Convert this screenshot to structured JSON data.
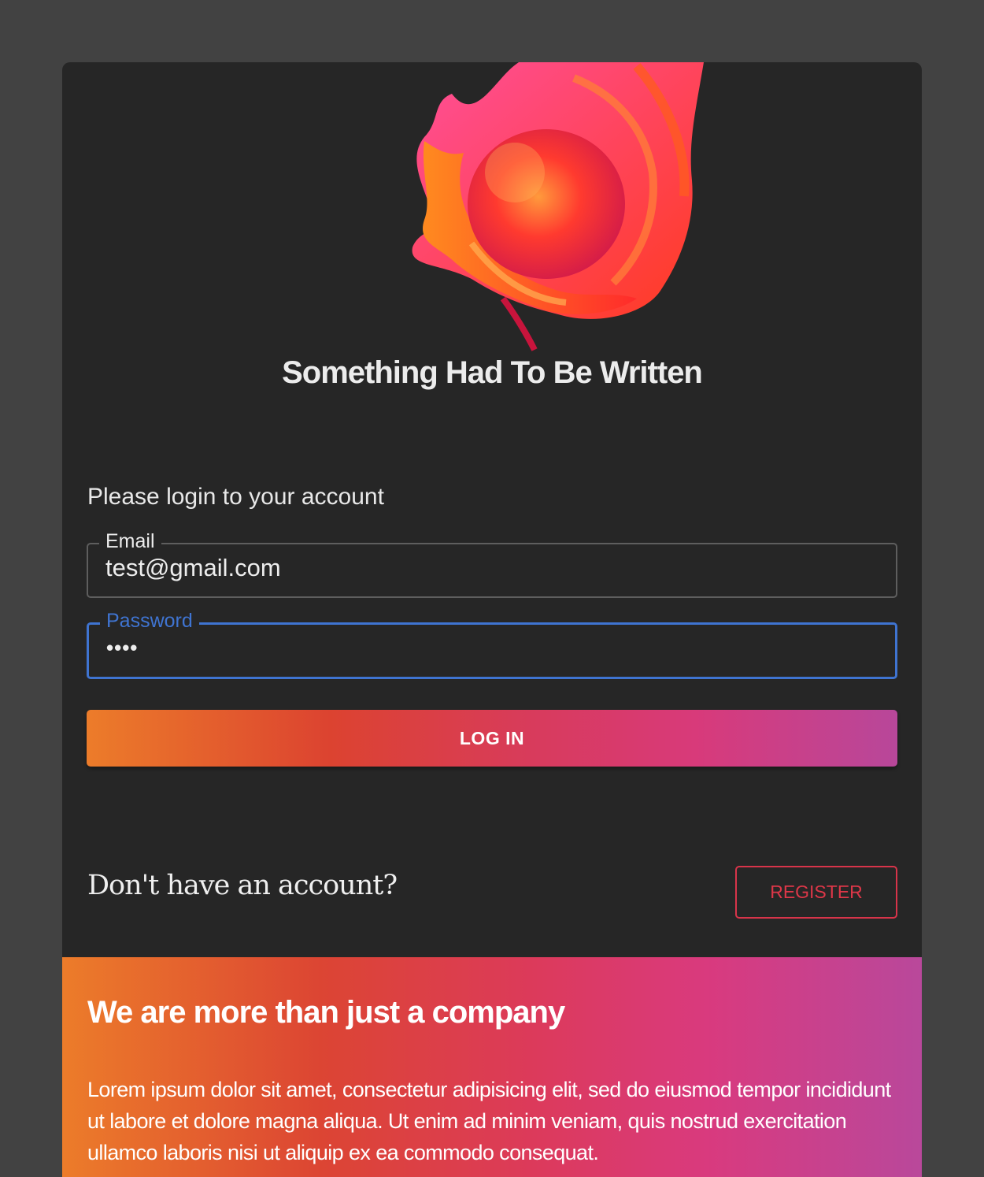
{
  "brand": {
    "title": "Something Had To Be Written",
    "logo_icon": "abstract-flame-logo",
    "colors": {
      "primary_start": "#ec7c2a",
      "primary_mid": "#d83b5c",
      "primary_end": "#b8479a",
      "focus": "#3f74d1",
      "card_bg": "#262626",
      "page_bg": "#424242"
    }
  },
  "login": {
    "prompt": "Please login to your account",
    "email": {
      "label": "Email",
      "value": "test@gmail.com"
    },
    "password": {
      "label": "Password",
      "masked_value": "••••"
    },
    "submit_label": "LOG IN"
  },
  "signup": {
    "question": "Don't have an account?",
    "register_label": "REGISTER"
  },
  "promo": {
    "title": "We are more than just a company",
    "body": "Lorem ipsum dolor sit amet, consectetur adipisicing elit, sed do eiusmod tempor incididunt ut labore et dolore magna aliqua. Ut enim ad minim veniam, quis nostrud exercitation ullamco laboris nisi ut aliquip ex ea commodo consequat."
  }
}
